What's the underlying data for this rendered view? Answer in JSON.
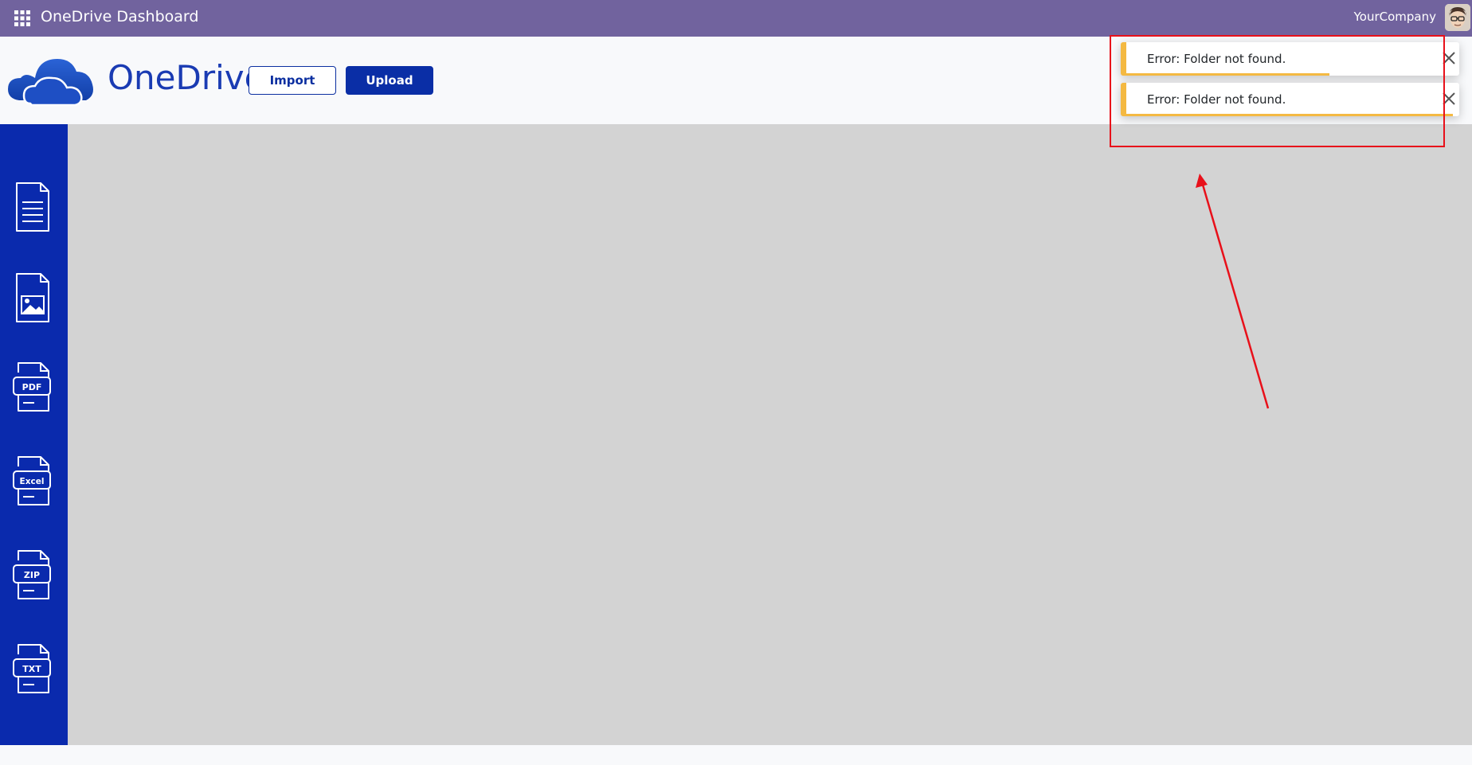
{
  "navbar": {
    "title": "OneDrive Dashboard",
    "company": "YourCompany",
    "bg_color": "#71639e"
  },
  "header": {
    "brand": "OneDrive",
    "import_label": "Import",
    "upload_label": "Upload",
    "brand_color": "#1a3bb3"
  },
  "sidebar": {
    "bg_color": "#0a2aad",
    "items": [
      {
        "icon": "document-icon",
        "label": ""
      },
      {
        "icon": "image-file-icon",
        "label": ""
      },
      {
        "icon": "pdf-file-icon",
        "label": "PDF"
      },
      {
        "icon": "excel-file-icon",
        "label": "Excel"
      },
      {
        "icon": "zip-file-icon",
        "label": "ZIP"
      },
      {
        "icon": "txt-file-icon",
        "label": "TXT"
      }
    ]
  },
  "notifications": [
    {
      "message": "Error: Folder not found.",
      "progress": 0.61
    },
    {
      "message": "Error: Folder not found.",
      "progress": 0.98
    }
  ],
  "colors": {
    "warning": "#f4b942",
    "annotation": "#e8101a",
    "content_bg": "#d3d3d3"
  }
}
